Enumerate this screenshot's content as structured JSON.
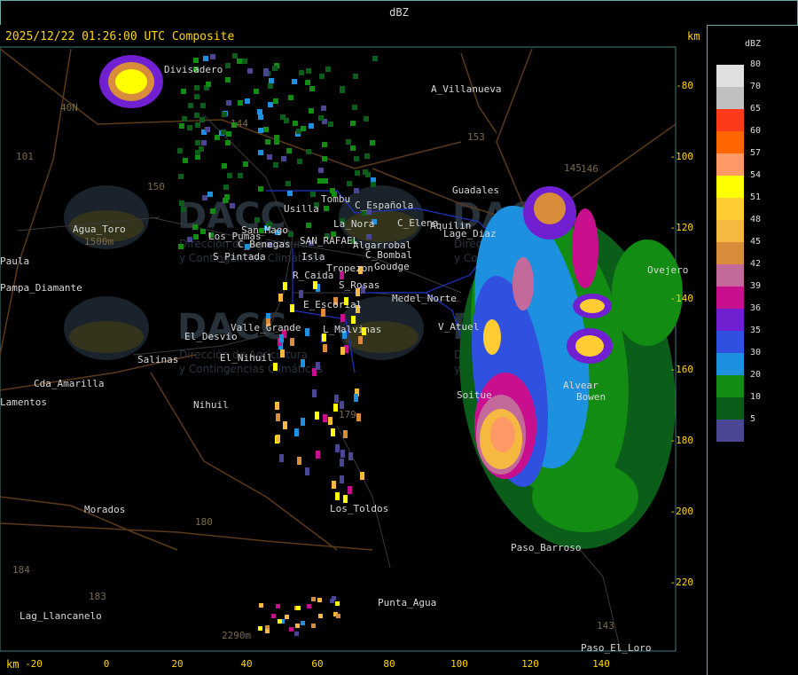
{
  "header": {
    "title": "dBZ"
  },
  "map": {
    "timestamp": "2025/12/22 01:26:00 UTC Composite",
    "unit_label": "km",
    "x_ticks": [
      "-20",
      "0",
      "20",
      "40",
      "60",
      "80",
      "100",
      "120",
      "140"
    ],
    "y_ticks": [
      "-80",
      "-100",
      "-120",
      "-140",
      "-160",
      "-180",
      "-200",
      "-220"
    ],
    "places": [
      "Divisadero",
      "A_Villanueva",
      "Guadales",
      "101",
      "40N",
      "153",
      "150",
      "Usilla",
      "Tombu",
      "C_Española",
      "C_Elena",
      "Aquilin",
      "La_Nora",
      "Agua_Toro",
      "1500m",
      "Los_Pumas",
      "San_Mago",
      "S_Pintada",
      "C_Benegas",
      "SAN_RAFAEL",
      "Algarrobal",
      "C_Bombal",
      "Isla",
      "Lage_Diaz",
      "Pampa_Diamante",
      "Paula",
      "R_Caida",
      "Tropezon",
      "Goudge",
      "S_Rosas",
      "Medel_Norte",
      "E_Escorial",
      "El_Desvio",
      "Valle_Grande",
      "L_Malvinas",
      "V_Atuel",
      "Ovejero",
      "Salinas",
      "El_Nihuil",
      "Nihuil",
      "Cda_Amarilla",
      "Bowen",
      "Alvear",
      "Soitue",
      "Lamentos",
      "Morados",
      "Los_Toldos",
      "184",
      "179",
      "Paso_Barroso",
      "183",
      "Punta_Agua",
      "Lag_Llancanelo",
      "2290m",
      "Paso_El_Loro",
      "180",
      "143",
      "144",
      "145",
      "146"
    ],
    "watermark": {
      "brand": "DACC",
      "line1": "Dirección de Agricultura",
      "line2": "y Contingencias Climáticas"
    }
  },
  "legend": {
    "title": "dBZ",
    "levels": [
      {
        "label": "80",
        "color": "#e0e0e0"
      },
      {
        "label": "70",
        "color": "#c0c0c0"
      },
      {
        "label": "65",
        "color": "#ff3a1a"
      },
      {
        "label": "60",
        "color": "#ff6600"
      },
      {
        "label": "57",
        "color": "#ff9966"
      },
      {
        "label": "54",
        "color": "#ffff00"
      },
      {
        "label": "51",
        "color": "#ffcc33"
      },
      {
        "label": "48",
        "color": "#f5b942"
      },
      {
        "label": "45",
        "color": "#d98c3a"
      },
      {
        "label": "42",
        "color": "#c46a9a"
      },
      {
        "label": "39",
        "color": "#c8108f"
      },
      {
        "label": "36",
        "color": "#7020d0"
      },
      {
        "label": "35",
        "color": "#3050e0"
      },
      {
        "label": "30",
        "color": "#1e90e0"
      },
      {
        "label": "20",
        "color": "#128c12"
      },
      {
        "label": "10",
        "color": "#0b5e1a"
      },
      {
        "label": "5",
        "color": "#4a4694"
      }
    ]
  }
}
